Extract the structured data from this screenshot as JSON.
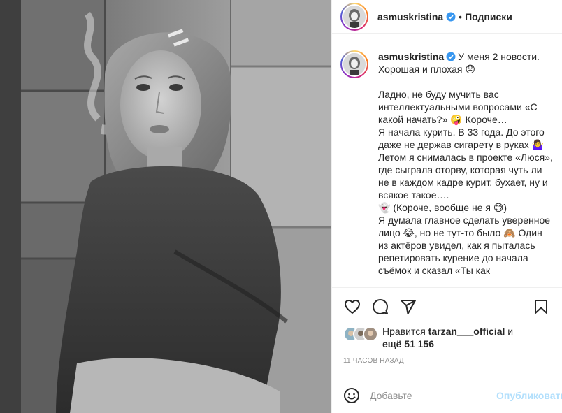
{
  "post": {
    "username": "asmuskristina",
    "dot": "•",
    "follow_label": "Подписки",
    "caption": {
      "username": "asmuskristina",
      "lines": [
        "У меня 2 новости.",
        "Хорошая и плохая 😞",
        "",
        "Ладно, не буду мучить вас интеллектуальными вопросами «С какой начать?» 🤪 Короче…",
        "Я начала курить. В 33 года. До этого даже не держав сигарету в руках 🤷‍♀️",
        "Летом я снималась в проекте «Люся», где сыграла оторву, которая чуть ли не в каждом кадре курит, бухает, ну и всякое такое….",
        "👻 (Короче, вообще не я 😅)",
        "Я думала главное сделать уверенное лицо 😂, но не тут-то было 🙈 Один из актёров увидел, как я пыталась репетировать курение до начала съёмок и сказал «Ты как"
      ]
    },
    "likes": {
      "prefix": "Нравится ",
      "liker_name": "tarzan___official",
      "middle": " и",
      "count_text": "ещё 51 156"
    },
    "timestamp": "11 часов назад",
    "comment": {
      "placeholder": "Добавьте",
      "publish_label": "Опубликовать"
    },
    "icons": {
      "like": "heart-icon",
      "comment": "comment-bubble-icon",
      "share": "paper-plane-icon",
      "save": "bookmark-icon",
      "emoji": "smiley-icon",
      "verified": "verified-badge-icon"
    },
    "colors": {
      "verified": "#3897f0",
      "publish_disabled": "#b2dffc",
      "muted_text": "#8e8e8e",
      "text": "#262626"
    }
  }
}
